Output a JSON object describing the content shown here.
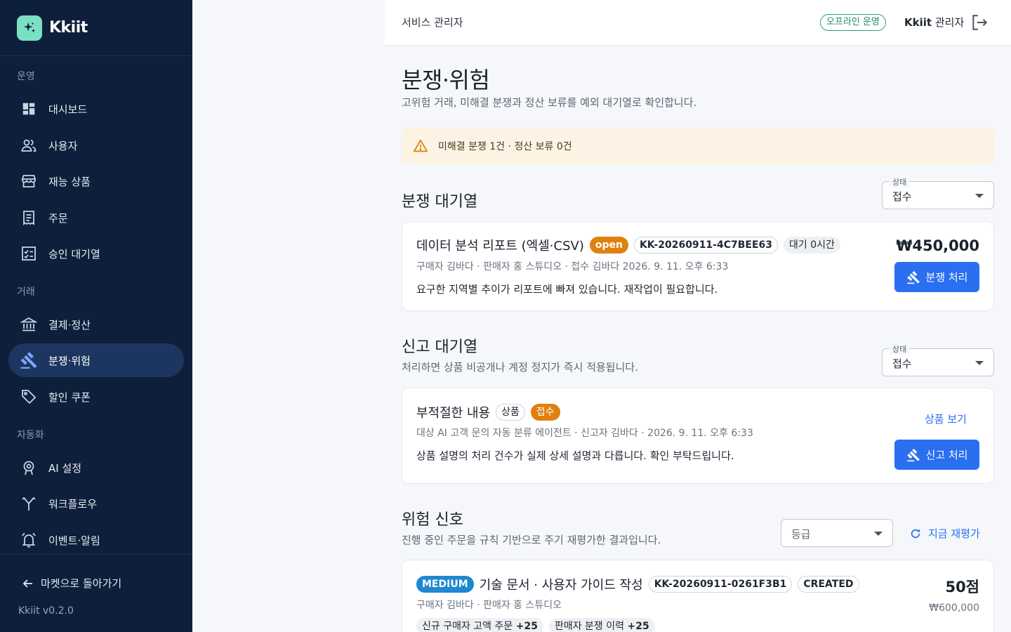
{
  "brand": {
    "name": "Kkiit"
  },
  "sidebar": {
    "sections": [
      {
        "label": "운영"
      },
      {
        "label": "거래"
      },
      {
        "label": "자동화"
      }
    ],
    "items": [
      {
        "label": "대시보드",
        "icon": "dashboard-icon"
      },
      {
        "label": "사용자",
        "icon": "users-icon"
      },
      {
        "label": "재능 상품",
        "icon": "store-icon"
      },
      {
        "label": "주문",
        "icon": "receipt-icon"
      },
      {
        "label": "승인 대기열",
        "icon": "checklist-icon"
      },
      {
        "label": "결제·정산",
        "icon": "bank-icon"
      },
      {
        "label": "분쟁·위험",
        "icon": "gavel-icon",
        "active": true
      },
      {
        "label": "할인 쿠폰",
        "icon": "tag-icon"
      },
      {
        "label": "AI 설정",
        "icon": "ai-settings-icon"
      },
      {
        "label": "워크플로우",
        "icon": "workflow-icon"
      },
      {
        "label": "이벤트·알림",
        "icon": "bell-icon"
      }
    ],
    "back_label": "마켓으로 돌아가기",
    "version": "Kkiit v0.2.0"
  },
  "header": {
    "title": "서비스 관리자",
    "mode_badge": "오프라인 운영",
    "admin_brand": "Kkiit",
    "admin_role": "관리자"
  },
  "page": {
    "title": "분쟁·위험",
    "subtitle": "고위험 거래, 미해결 분쟁과 정산 보류를 예외 대기열로 확인합니다.",
    "alert": "미해결 분쟁 1건 · 정산 보류 0건"
  },
  "dispute_queue": {
    "title": "분쟁 대기열",
    "filter_label": "상태",
    "filter_value": "접수",
    "cards": [
      {
        "title": "데이터 분석 리포트 (엑셀·CSV)",
        "status": "open",
        "order_id": "KK-20260911-4C7BEE63",
        "wait": "대기 0시간",
        "meta": "구매자 김바다 · 판매자 홍 스튜디오 · 접수 김바다 2026. 9. 11. 오후 6:33",
        "body": "요구한 지역별 추이가 리포트에 빠져 있습니다. 재작업이 필요합니다.",
        "amount": "₩450,000",
        "action": "분쟁 처리"
      }
    ]
  },
  "report_queue": {
    "title": "신고 대기열",
    "description": "처리하면 상품 비공개나 계정 정지가 즉시 적용됩니다.",
    "filter_label": "상태",
    "filter_value": "접수",
    "cards": [
      {
        "title": "부적절한 내용",
        "target_type": "상품",
        "status": "접수",
        "meta": "대상 AI 고객 문의 자동 분류 에이전트 · 신고자 김바다 · 2026. 9. 11. 오후 6:33",
        "body": "상품 설명의 처리 건수가 실제 상세 설명과 다릅니다. 확인 부탁드립니다.",
        "link": "상품 보기",
        "action": "신고 처리"
      }
    ]
  },
  "risk_signals": {
    "title": "위험 신호",
    "description": "진행 중인 주문을 규칙 기반으로 주기 재평가한 결과입니다.",
    "filter_placeholder": "등급",
    "reevaluate_label": "지금 재평가",
    "cards": [
      {
        "level": "MEDIUM",
        "title": "기술 문서 · 사용자 가이드 작성",
        "order_id": "KK-20260911-0261F3B1",
        "state": "CREATED",
        "meta": "구매자 김바다 · 판매자 홍 스튜디오",
        "score": "50점",
        "amount": "₩600,000",
        "signals": [
          {
            "label": "신규 구매자 고액 주문",
            "points": "+25"
          },
          {
            "label": "판매자 분쟁 이력",
            "points": "+25"
          }
        ]
      }
    ]
  },
  "colors": {
    "sidebar_bg": "#0e1f3b",
    "sidebar_active": "#1d3660",
    "accent": "#2a6ff0",
    "warning": "#e0800f",
    "brand_logo": "#7be0c3",
    "medium_badge": "#1e88d0"
  }
}
